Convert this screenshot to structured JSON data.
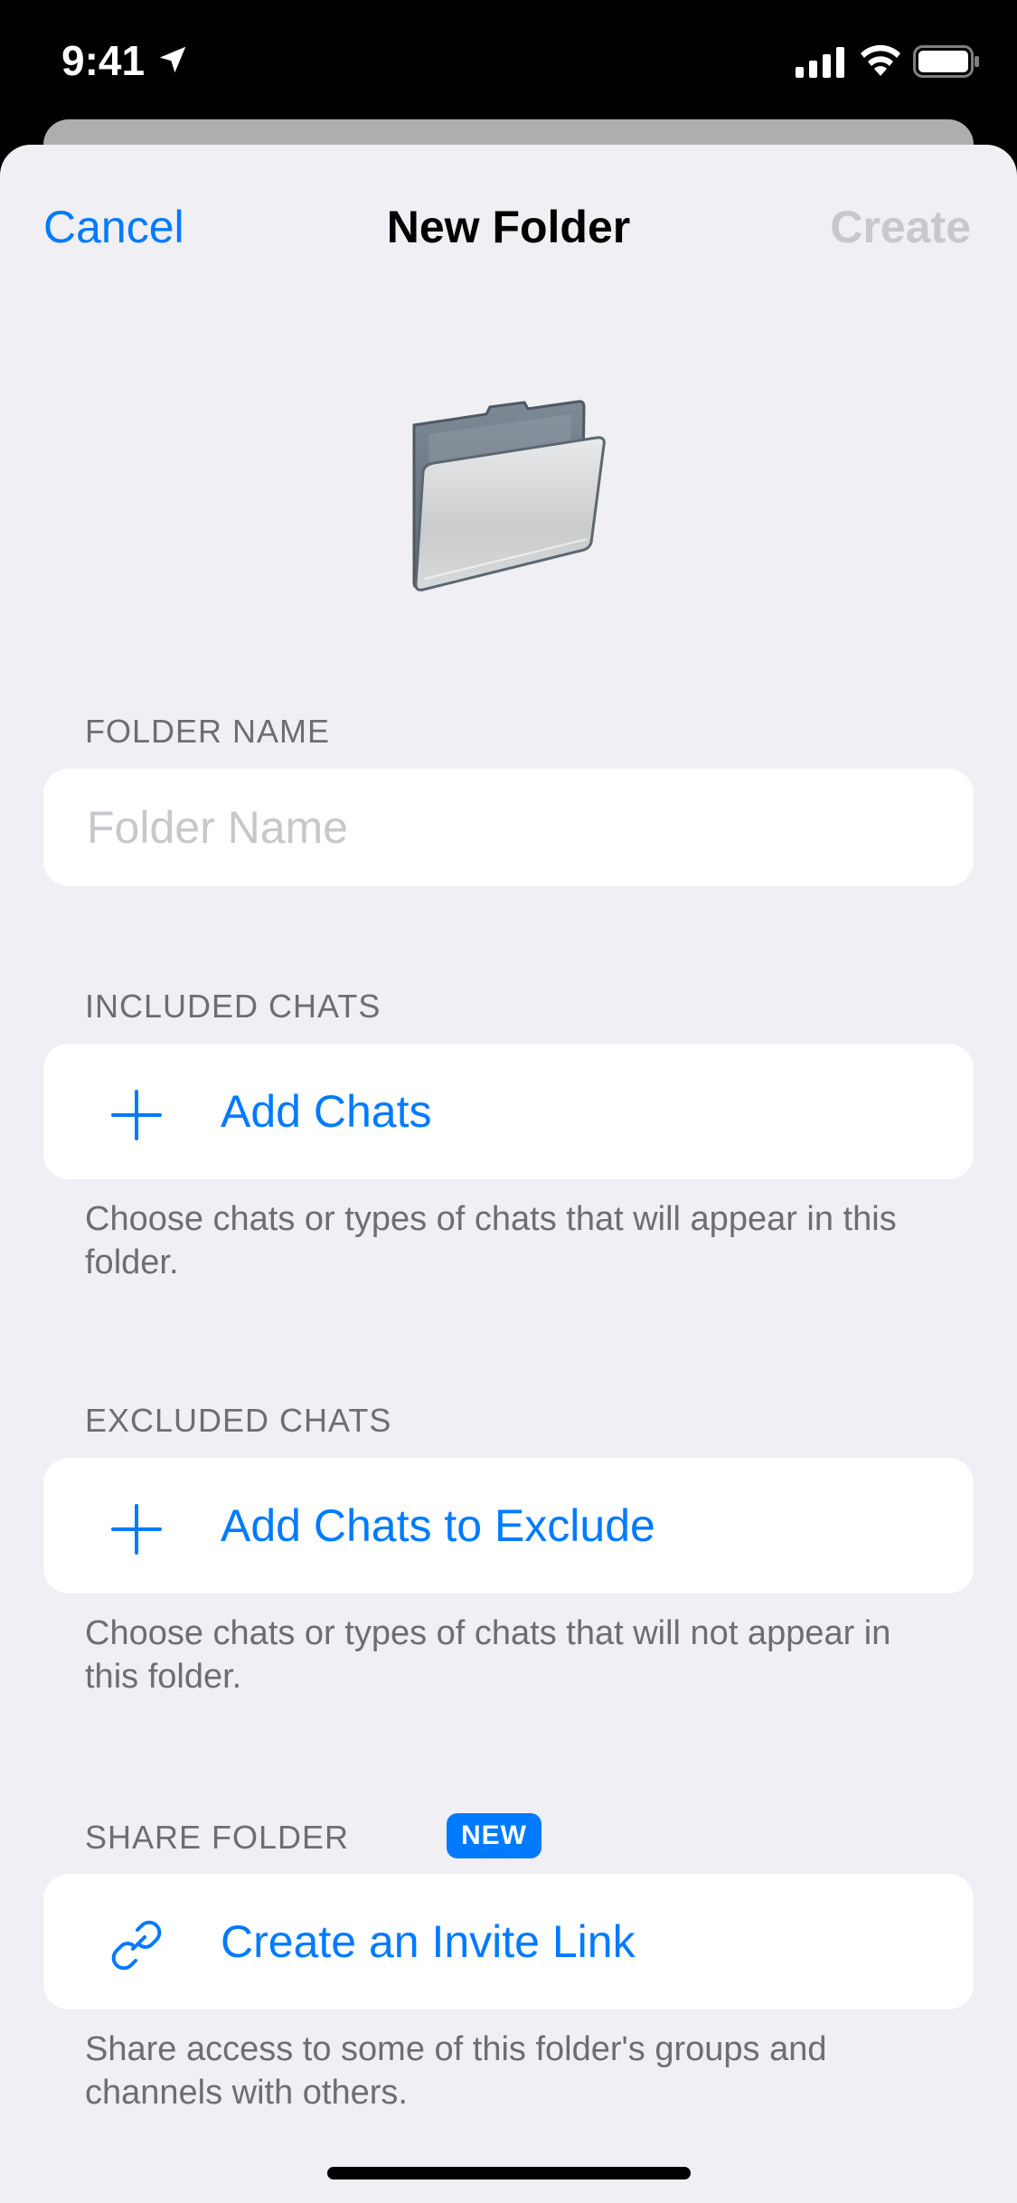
{
  "status_bar": {
    "time": "9:41"
  },
  "nav": {
    "cancel_label": "Cancel",
    "title": "New Folder",
    "create_label": "Create"
  },
  "folder_name": {
    "header": "FOLDER NAME",
    "placeholder": "Folder Name",
    "value": ""
  },
  "included": {
    "header": "INCLUDED CHATS",
    "add_label": "Add Chats",
    "footer": "Choose chats or types of chats that will appear in this folder."
  },
  "excluded": {
    "header": "EXCLUDED CHATS",
    "add_label": "Add Chats to Exclude",
    "footer": "Choose chats or types of chats that will not appear in this folder."
  },
  "share": {
    "header": "SHARE FOLDER",
    "badge": "NEW",
    "link_label": "Create an Invite Link",
    "footer": "Share access to some of this folder's groups and channels with others."
  },
  "icons": {
    "plus": "plus-icon",
    "link": "link-icon",
    "folder": "folder-icon"
  },
  "colors": {
    "accent": "#007aff",
    "disabled": "#c7c7cc",
    "background": "#efeff4",
    "secondary_text": "#6d6d72"
  }
}
